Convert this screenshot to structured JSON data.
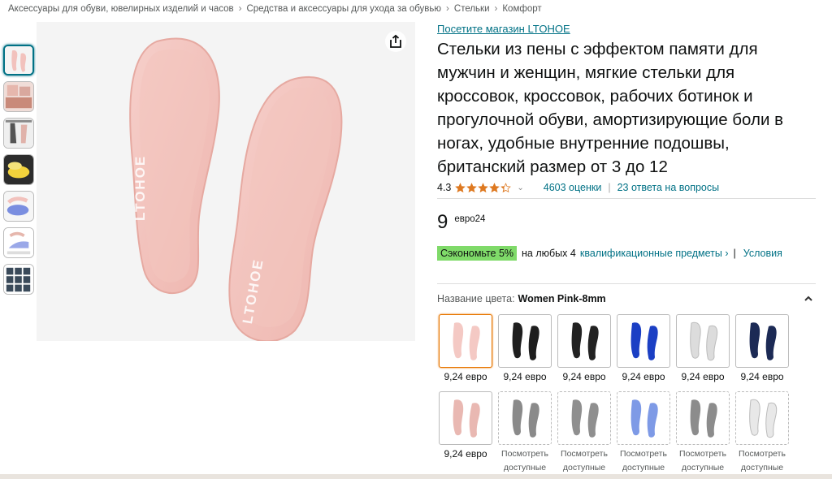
{
  "breadcrumb": [
    "Аксессуары для обуви, ювелирных изделий и часов",
    "Средства и аксессуары для ухода за обувью",
    "Стельки",
    "Комфорт"
  ],
  "breadcrumb_separator": "›",
  "product": {
    "store_link": "Посетите магазин LTOHOE",
    "title": "Стельки из пены с эффектом памяти для мужчин и женщин, мягкие стельки для кроссовок, кроссовок, рабочих ботинок и прогулочной обуви, амортизирующие боли в ногах, удобные внутренние подошвы, британский размер от 3 до 12",
    "brand_on_image": "LTOHOE",
    "rating_value": "4.3",
    "stars": 4.3,
    "ratings_count": "4603 оценки",
    "answers": "23 ответа на вопросы",
    "price_whole": "9",
    "price_fraction": "евро24",
    "savings_badge": "Сэкономьте 5%",
    "savings_text": "на любых 4",
    "savings_link": "квалификационные предметы ›",
    "savings_sep": "|",
    "conditions_link": "Условия"
  },
  "color": {
    "label": "Название цвета:",
    "selected": "Women Pink-8mm"
  },
  "swatches": [
    {
      "color": "#f4c9c4",
      "state": "selected",
      "price": "9,24 евро"
    },
    {
      "color": "#1e1e1e",
      "state": "available",
      "price": "9,24 евро"
    },
    {
      "color": "#222222",
      "state": "available",
      "price": "9,24 евро"
    },
    {
      "color": "#1b3fc4",
      "state": "available",
      "price": "9,24 евро"
    },
    {
      "color": "#dcdcdc",
      "state": "available",
      "price": "9,24 евро"
    },
    {
      "color": "#1c2a55",
      "state": "available",
      "price": "9,24 евро"
    },
    {
      "color": "#e9b8b2",
      "state": "available",
      "price": "9,24 евро"
    },
    {
      "color": "#8a8a8a",
      "state": "unavailable",
      "see": [
        "Посмотреть",
        "доступные"
      ]
    },
    {
      "color": "#8f8f8f",
      "state": "unavailable",
      "see": [
        "Посмотреть",
        "доступные"
      ]
    },
    {
      "color": "#7e9ae6",
      "state": "unavailable",
      "see": [
        "Посмотреть",
        "доступные"
      ]
    },
    {
      "color": "#8c8c8c",
      "state": "unavailable",
      "see": [
        "Посмотреть",
        "доступные"
      ]
    },
    {
      "color": "#e8e8e8",
      "state": "unavailable",
      "see": [
        "Посмотреть",
        "доступные"
      ]
    }
  ],
  "colors": {
    "link": "#007185",
    "star": "#de7921",
    "save_badge": "#7fda69",
    "selected_border": "#e77600",
    "insole_pink": "#f2c2bd"
  },
  "icons": {
    "share": "share-icon",
    "collapse": "chevron-up-icon",
    "rating_dropdown": "chevron-down-icon"
  }
}
